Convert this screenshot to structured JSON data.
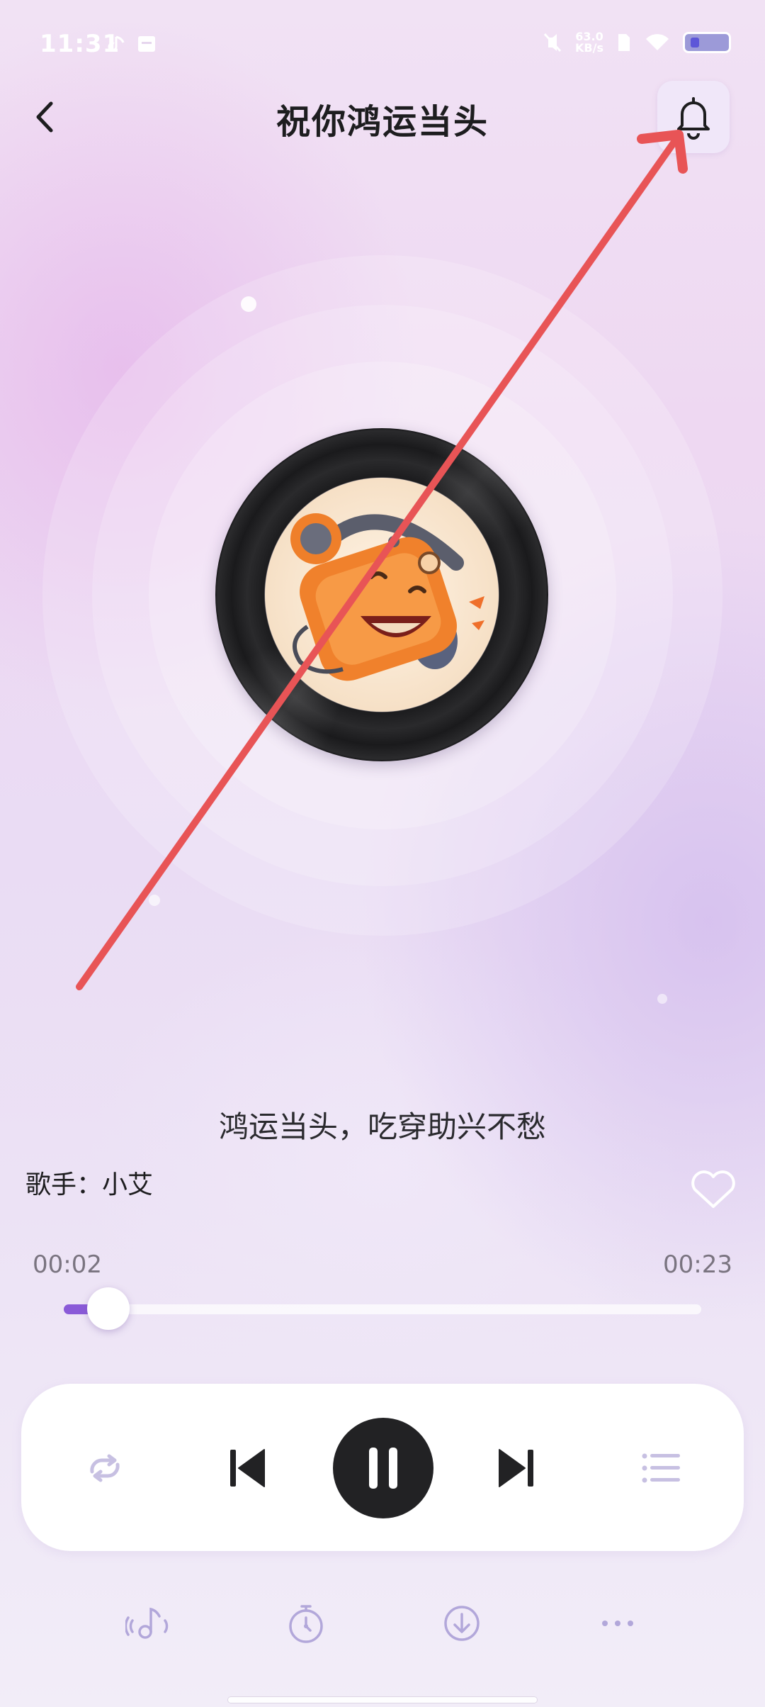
{
  "status_bar": {
    "time": "11:31",
    "net_speed_value": "63.0",
    "net_speed_unit": "KB/s"
  },
  "header": {
    "title": "祝你鸿运当头"
  },
  "player": {
    "lyric": "鸿运当头，吃穿助兴不愁",
    "singer_label": "歌手：",
    "singer_name": "小艾",
    "current_time": "00:02",
    "total_time": "00:23",
    "progress": 0.07,
    "is_playing": true
  },
  "controls": {
    "repeat_icon": "repeat-icon",
    "prev_icon": "skip-previous-icon",
    "play_pause_icon": "pause-icon",
    "next_icon": "skip-next-icon",
    "playlist_icon": "playlist-icon"
  },
  "toolbar": {
    "items": [
      "ringtone-icon",
      "timer-icon",
      "download-icon",
      "more-icon"
    ]
  },
  "colors": {
    "accent": "#8a5ad8",
    "annotation_arrow": "#e85456"
  }
}
